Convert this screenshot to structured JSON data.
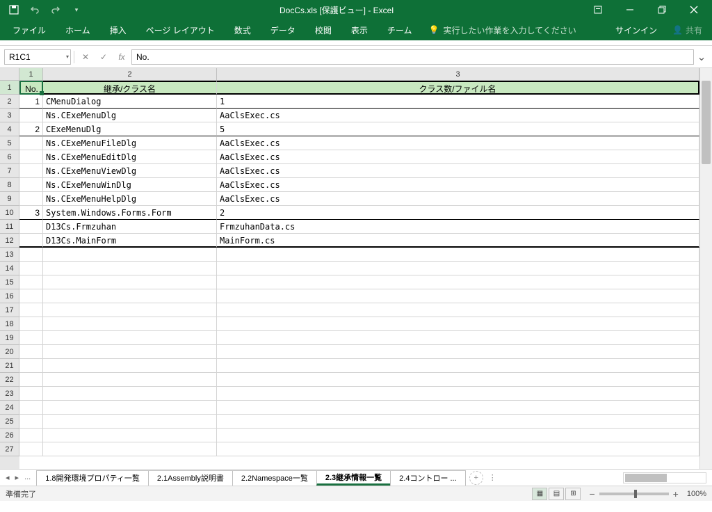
{
  "title": "DocCs.xls [保護ビュー] - Excel",
  "qat": {
    "save": "save",
    "undo": "undo",
    "redo": "redo"
  },
  "win": {
    "ribbon_opts": "ribbon-display-options",
    "min": "minimize",
    "max": "restore",
    "close": "close"
  },
  "tabs": {
    "file": "ファイル",
    "home": "ホーム",
    "insert": "挿入",
    "page_layout": "ページ レイアウト",
    "formulas": "数式",
    "data": "データ",
    "review": "校閲",
    "view": "表示",
    "team": "チーム"
  },
  "tell_me": "実行したい作業を入力してください",
  "sign_in": "サインイン",
  "share": "共有",
  "name_box": "R1C1",
  "formula_value": "No.",
  "col_headers": [
    "1",
    "2",
    "3"
  ],
  "row_headers": [
    "1",
    "2",
    "3",
    "4",
    "5",
    "6",
    "7",
    "8",
    "9",
    "10",
    "11",
    "12",
    "13",
    "14",
    "15",
    "16",
    "17",
    "18",
    "19",
    "20",
    "21",
    "22",
    "23",
    "24",
    "25",
    "26",
    "27"
  ],
  "header_row": {
    "c1": "No.",
    "c2": "継承/クラス名",
    "c3": "クラス数/ファイル名"
  },
  "rows": [
    {
      "no": "1",
      "name": "CMenuDialog",
      "file": "1",
      "group": true
    },
    {
      "no": "",
      "name": "Ns.CExeMenuDlg",
      "file": "AaClsExec.cs"
    },
    {
      "no": "2",
      "name": "CExeMenuDlg",
      "file": "5",
      "group": true
    },
    {
      "no": "",
      "name": "Ns.CExeMenuFileDlg",
      "file": "AaClsExec.cs"
    },
    {
      "no": "",
      "name": "Ns.CExeMenuEditDlg",
      "file": "AaClsExec.cs"
    },
    {
      "no": "",
      "name": "Ns.CExeMenuViewDlg",
      "file": "AaClsExec.cs"
    },
    {
      "no": "",
      "name": "Ns.CExeMenuWinDlg",
      "file": "AaClsExec.cs"
    },
    {
      "no": "",
      "name": "Ns.CExeMenuHelpDlg",
      "file": "AaClsExec.cs"
    },
    {
      "no": "3",
      "name": "System.Windows.Forms.Form",
      "file": "2",
      "group": true
    },
    {
      "no": "",
      "name": "D13Cs.Frmzuhan",
      "file": "FrmzuhanData.cs"
    },
    {
      "no": "",
      "name": "D13Cs.MainForm",
      "file": "MainForm.cs",
      "last": true
    }
  ],
  "sheet_tabs": [
    {
      "label": "1.8開発環境プロパティ一覧",
      "active": false
    },
    {
      "label": "2.1Assembly説明書",
      "active": false
    },
    {
      "label": "2.2Namespace一覧",
      "active": false
    },
    {
      "label": "2.3継承情報一覧",
      "active": true
    },
    {
      "label": "2.4コントロー ...",
      "active": false
    }
  ],
  "tab_ellipsis": "...",
  "status": "準備完了",
  "zoom": "100%"
}
